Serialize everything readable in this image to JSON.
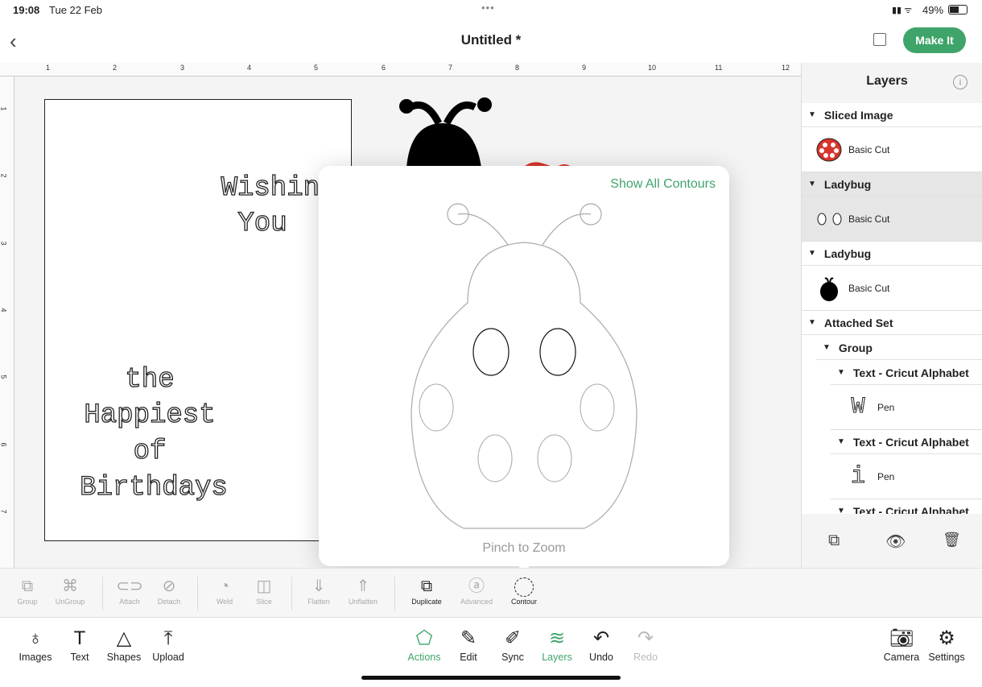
{
  "status": {
    "time": "19:08",
    "date": "Tue 22 Feb",
    "battery": "49%"
  },
  "header": {
    "title": "Untitled *",
    "make_it": "Make It"
  },
  "ruler": {
    "top": [
      "1",
      "2",
      "3",
      "4",
      "5",
      "6",
      "7",
      "8",
      "9",
      "10",
      "11",
      "12"
    ],
    "left": [
      "1",
      "2",
      "3",
      "4",
      "5",
      "6",
      "7"
    ]
  },
  "canvas": {
    "text1": "Wishing",
    "text2": "You",
    "text3": "the",
    "text4": "Happiest",
    "text5": "of",
    "text6": "Birthdays"
  },
  "popup": {
    "show_all": "Show All Contours",
    "hint": "Pinch to Zoom"
  },
  "layers": {
    "title": "Layers",
    "groups": [
      {
        "name": "Sliced Image",
        "item": "Basic Cut"
      },
      {
        "name": "Ladybug",
        "item": "Basic Cut"
      },
      {
        "name": "Ladybug",
        "item": "Basic Cut"
      },
      {
        "name": "Attached Set"
      },
      {
        "name": "Group"
      },
      {
        "name": "Text - Cricut Alphabet",
        "item": "Pen",
        "glyph": "W"
      },
      {
        "name": "Text - Cricut Alphabet",
        "item": "Pen",
        "glyph": "i"
      },
      {
        "name": "Text - Cricut Alphabet"
      }
    ]
  },
  "toolbar": {
    "group": "Group",
    "ungroup": "UnGroup",
    "attach": "Attach",
    "detach": "Detach",
    "weld": "Weld",
    "slice": "Slice",
    "flatten": "Flatten",
    "unflatten": "Unflatten",
    "duplicate": "Duplicate",
    "advanced": "Advanced",
    "contour": "Contour"
  },
  "bottom": {
    "images": "Images",
    "text": "Text",
    "shapes": "Shapes",
    "upload": "Upload",
    "actions": "Actions",
    "edit": "Edit",
    "sync": "Sync",
    "layers": "Layers",
    "undo": "Undo",
    "redo": "Redo",
    "camera": "Camera",
    "settings": "Settings"
  },
  "colors": {
    "accent": "#3fa46a",
    "ladybug_red": "#d9342b"
  }
}
